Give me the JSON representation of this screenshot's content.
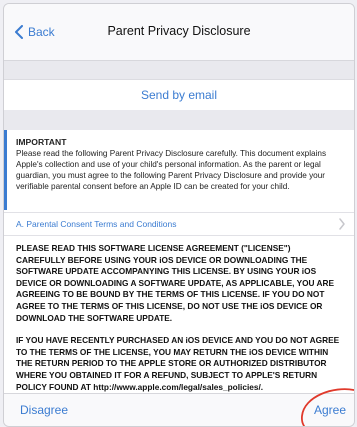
{
  "navbar": {
    "back_label": "Back",
    "title": "Parent Privacy Disclosure"
  },
  "email": {
    "label": "Send by email"
  },
  "important": {
    "heading": "IMPORTANT",
    "body": "Please read the following Parent Privacy Disclosure carefully. This document explains Apple's collection and use of your child's personal information. As the parent or legal guardian, you must agree to the following Parent Privacy Disclosure and provide your verifiable parental consent before an Apple ID can be created for your child."
  },
  "terms_link": {
    "label": "A. Parental Consent Terms and Conditions"
  },
  "license": {
    "paragraph1": "PLEASE READ THIS SOFTWARE LICENSE AGREEMENT (\"LICENSE\") CAREFULLY BEFORE USING YOUR iOS DEVICE OR DOWNLOADING THE SOFTWARE UPDATE ACCOMPANYING THIS LICENSE. BY USING YOUR iOS DEVICE OR DOWNLOADING A SOFTWARE UPDATE, AS APPLICABLE, YOU ARE AGREEING TO BE BOUND BY THE TERMS OF THIS LICENSE. IF YOU DO NOT AGREE TO THE TERMS OF THIS LICENSE, DO NOT USE THE iOS DEVICE OR DOWNLOAD THE SOFTWARE UPDATE.",
    "paragraph2": "IF YOU HAVE RECENTLY PURCHASED AN iOS DEVICE AND YOU DO NOT AGREE TO THE TERMS OF THE LICENSE, YOU MAY RETURN THE iOS DEVICE WITHIN THE RETURN PERIOD TO THE APPLE STORE OR AUTHORIZED DISTRIBUTOR WHERE YOU OBTAINED IT FOR A REFUND, SUBJECT TO APPLE'S RETURN POLICY FOUND AT http://www.apple.com/legal/sales_policies/."
  },
  "toolbar": {
    "disagree_label": "Disagree",
    "agree_label": "Agree"
  },
  "colors": {
    "accent": "#3b7cd1",
    "background": "#efeff4",
    "annotation_circle": "#e0392b"
  },
  "icons": [
    "chevron-left-icon",
    "chevron-right-icon"
  ]
}
